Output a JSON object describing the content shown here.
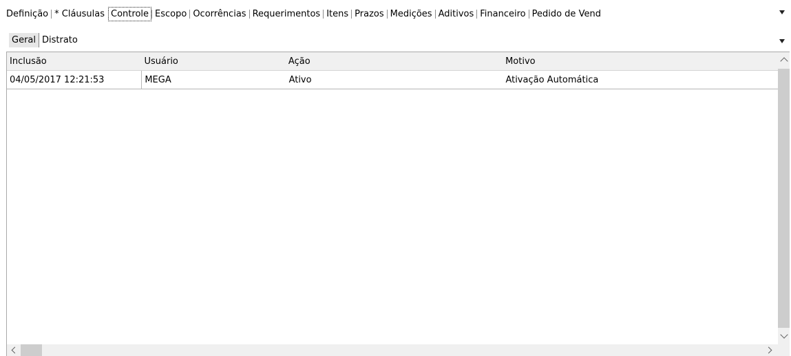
{
  "tabs": [
    {
      "label": "Definição"
    },
    {
      "label": "* Cláusulas"
    },
    {
      "label": "Controle",
      "active": true
    },
    {
      "label": "Escopo"
    },
    {
      "label": "Ocorrências"
    },
    {
      "label": "Requerimentos"
    },
    {
      "label": "Itens"
    },
    {
      "label": "Prazos"
    },
    {
      "label": "Medições"
    },
    {
      "label": "Aditivos"
    },
    {
      "label": "Financeiro"
    },
    {
      "label": "Pedido de Vend"
    }
  ],
  "subtabs": [
    {
      "label": "Geral",
      "active": true
    },
    {
      "label": "Distrato"
    }
  ],
  "grid": {
    "columns": [
      "Inclusão",
      "Usuário",
      "Ação",
      "Motivo"
    ],
    "rows": [
      [
        "04/05/2017 12:21:53",
        "MEGA",
        "Ativo",
        "Ativação Automática"
      ]
    ]
  }
}
